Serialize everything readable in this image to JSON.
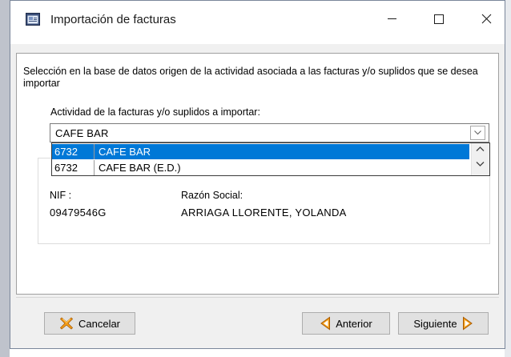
{
  "window": {
    "title": "Importación de facturas",
    "minimize_label": "minimize",
    "maximize_label": "maximize",
    "close_label": "close"
  },
  "description": "Selección en la base de datos origen de la actividad asociada a las facturas y/o suplidos que se desea importar",
  "activity": {
    "label": "Actividad de la facturas y/o suplidos a importar:",
    "selected": "CAFE BAR",
    "options": [
      {
        "code": "6732",
        "name": "CAFE BAR",
        "selected": true
      },
      {
        "code": "6732",
        "name": "CAFE BAR (E.D.)",
        "selected": false
      }
    ]
  },
  "details": {
    "nif_label": "NIF :",
    "nif_value": "09479546G",
    "razon_label": "Razón Social:",
    "razon_value": "ARRIAGA LLORENTE, YOLANDA"
  },
  "buttons": {
    "cancel": "Cancelar",
    "previous": "Anterior",
    "next": "Siguiente"
  },
  "colors": {
    "selection": "#0078d7",
    "icon_red": "#d0312d",
    "icon_orange": "#f6a01a"
  },
  "icons": {
    "app": "app-window-icon",
    "cancel": "cancel-x-icon",
    "previous": "arrow-left-icon",
    "next": "arrow-right-icon"
  }
}
